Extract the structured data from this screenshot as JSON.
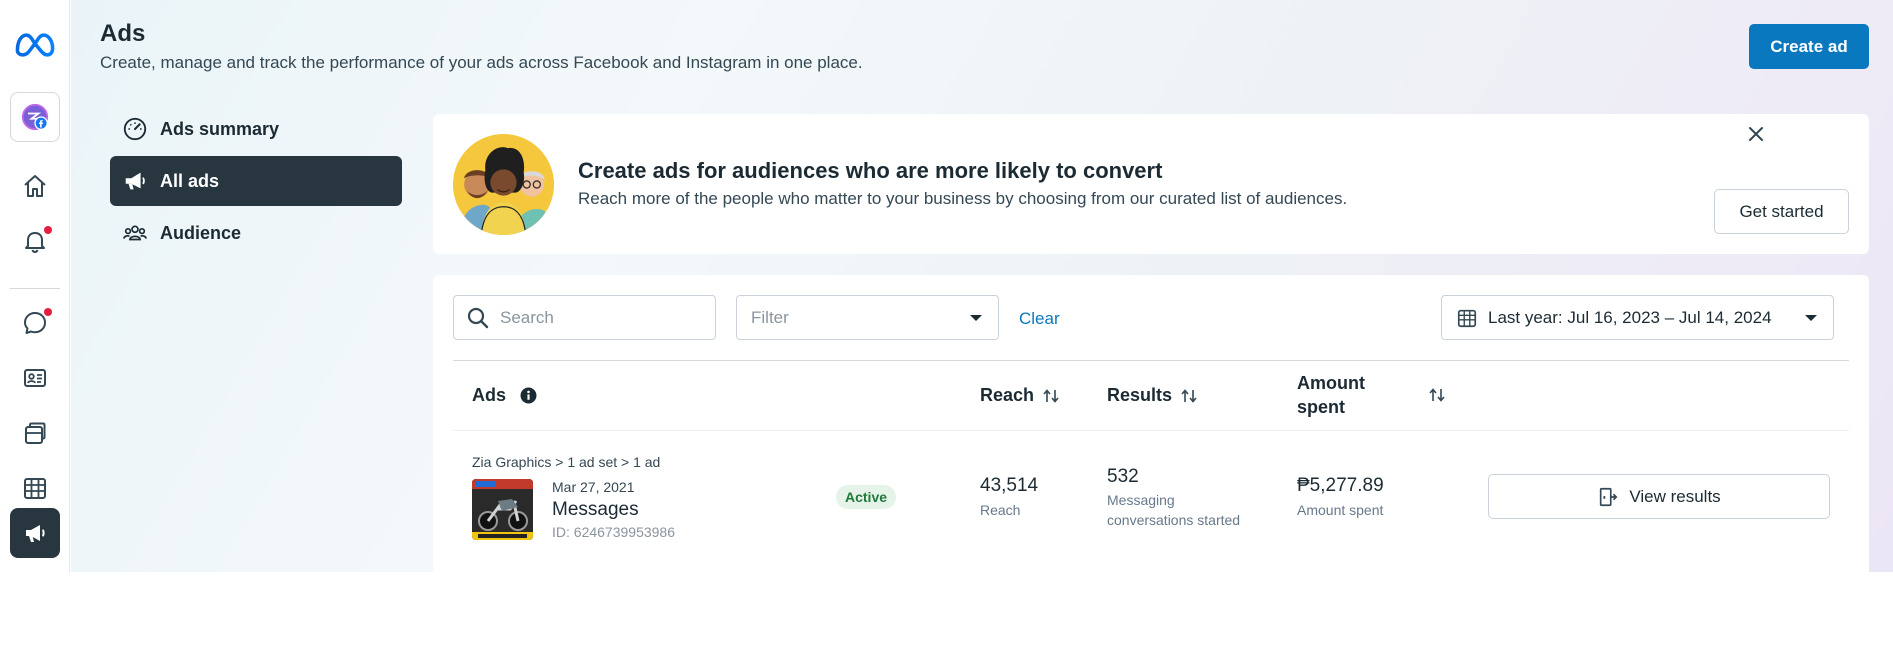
{
  "header": {
    "title": "Ads",
    "subtitle": "Create, manage and track the performance of your ads across Facebook and Instagram in one place.",
    "create_label": "Create ad"
  },
  "rail": {
    "icons": [
      "meta-logo-icon",
      "page-profile-icon",
      "home-icon",
      "notifications-icon",
      "messages-icon",
      "contacts-icon",
      "content-icon",
      "planner-icon",
      "ads-icon"
    ],
    "notification_dot_color": "#e41e3f"
  },
  "nav": {
    "items": [
      {
        "label": "Ads summary",
        "icon": "gauge-icon"
      },
      {
        "label": "All ads",
        "icon": "megaphone-icon"
      },
      {
        "label": "Audience",
        "icon": "people-icon"
      }
    ]
  },
  "promo": {
    "title": "Create ads for audiences who are more likely to convert",
    "subtitle": "Reach more of the people who matter to your business by choosing from our curated list of audiences.",
    "cta_label": "Get started"
  },
  "toolbar": {
    "search_placeholder": "Search",
    "filter_placeholder": "Filter",
    "clear_label": "Clear",
    "date_range_label": "Last year: Jul 16, 2023 – Jul 14, 2024"
  },
  "table": {
    "headers": {
      "ads": "Ads",
      "reach": "Reach",
      "results": "Results",
      "amount_line1": "Amount",
      "amount_line2": "spent"
    },
    "rows": [
      {
        "breadcrumb": "Zia Graphics > 1 ad set > 1 ad",
        "date": "Mar 27, 2021",
        "name": "Messages",
        "id": "ID: 6246739953986",
        "status": "Active",
        "reach": "43,514",
        "reach_label": "Reach",
        "results": "532",
        "results_label_line1": "Messaging",
        "results_label_line2": "conversations started",
        "amount": "₱5,277.89",
        "amount_label": "Amount spent",
        "action_label": "View results"
      }
    ]
  },
  "colors": {
    "brand_blue": "#0a78be",
    "active_nav": "#283640",
    "status_green": "#1f7a3b"
  }
}
